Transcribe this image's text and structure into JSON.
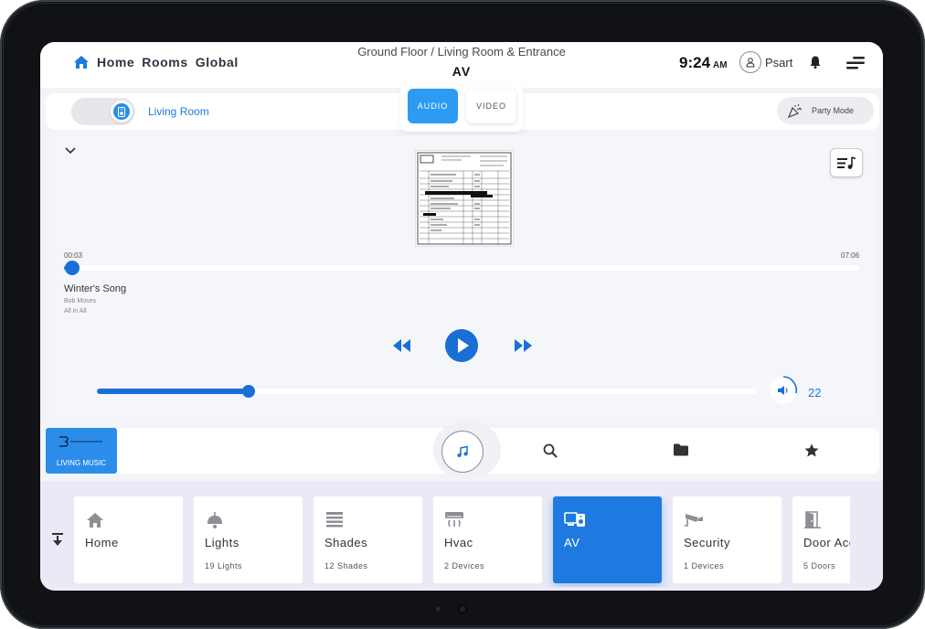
{
  "header": {
    "nav": [
      "Home",
      "Rooms",
      "Global"
    ],
    "breadcrumb": "Ground Floor / Living Room & Entrance",
    "title": "AV",
    "time": "9:24",
    "ampm": "AM",
    "user": "Psart"
  },
  "room": {
    "label": "Living Room",
    "party_mode": "Party Mode"
  },
  "av_tabs": [
    "AUDIO",
    "VIDEO"
  ],
  "player": {
    "current_time": "00:03",
    "total_time": "07:06",
    "progress": 0.01,
    "song": "Winter's Song",
    "artist": "Bob Moses",
    "album": "All in All",
    "volume": "22",
    "volume_fraction": 0.23
  },
  "source": {
    "label": "LIVING MUSIC"
  },
  "colors": {
    "accent": "#1a6fd6",
    "tab_active": "#2e9bf2"
  },
  "tiles": [
    {
      "name": "Home",
      "count": "",
      "icon": "home-icon"
    },
    {
      "name": "Lights",
      "count": "19 Lights",
      "icon": "lamp-icon"
    },
    {
      "name": "Shades",
      "count": "12 Shades",
      "icon": "shades-icon"
    },
    {
      "name": "Hvac",
      "count": "2 Devices",
      "icon": "hvac-icon"
    },
    {
      "name": "AV",
      "count": "",
      "icon": "av-icon",
      "active": true
    },
    {
      "name": "Security",
      "count": "1 Devices",
      "icon": "camera-icon"
    },
    {
      "name": "Door Access",
      "count": "5 Doors",
      "icon": "door-icon"
    }
  ]
}
